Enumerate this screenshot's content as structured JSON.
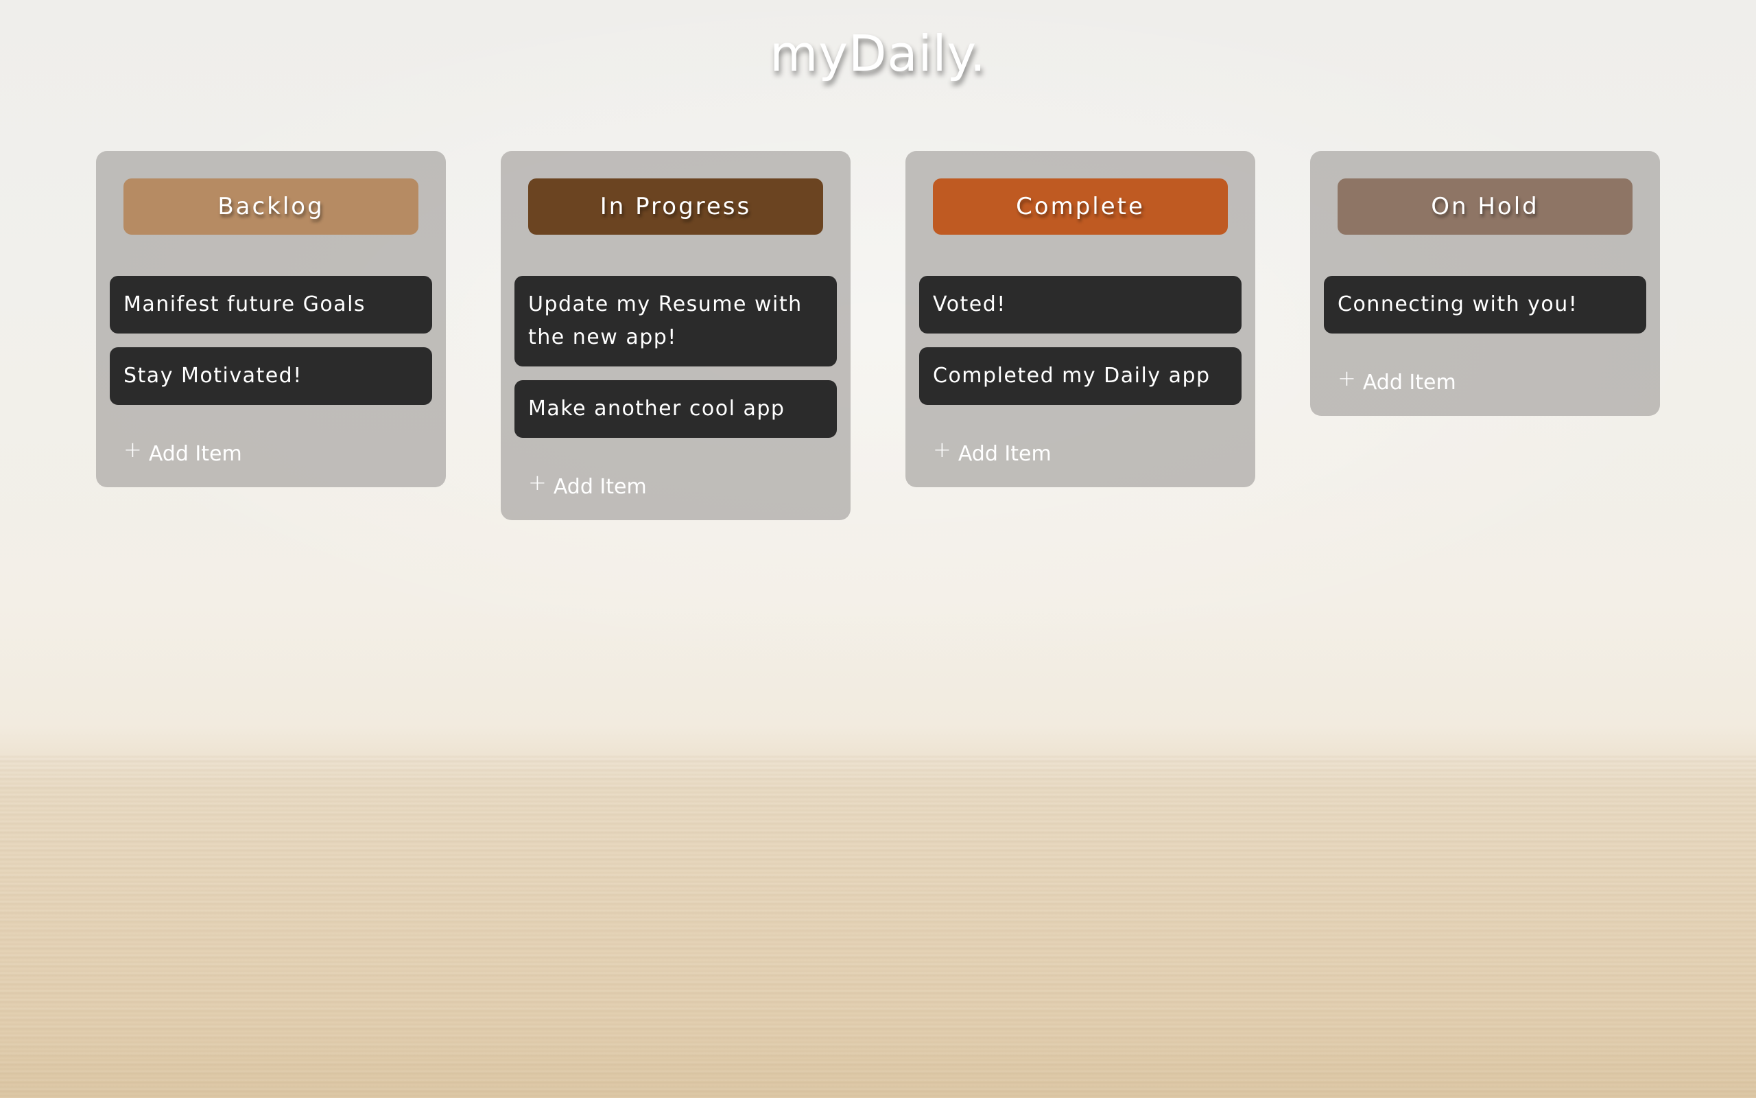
{
  "app": {
    "title": "myDaily."
  },
  "columns": [
    {
      "title": "Backlog",
      "color": "#b68b63",
      "items": [
        "Manifest future Goals",
        "Stay Motivated!"
      ],
      "add_label": "Add Item"
    },
    {
      "title": "In Progress",
      "color": "#6b4421",
      "items": [
        "Update my Resume with the new app!",
        "Make another cool app"
      ],
      "add_label": "Add Item"
    },
    {
      "title": "Complete",
      "color": "#bf5a22",
      "items": [
        "Voted!",
        "Completed my Daily app"
      ],
      "add_label": "Add Item"
    },
    {
      "title": "On Hold",
      "color": "#8e7565",
      "items": [
        "Connecting with you!"
      ],
      "add_label": "Add Item"
    }
  ],
  "icons": {
    "add": "plus-icon"
  }
}
